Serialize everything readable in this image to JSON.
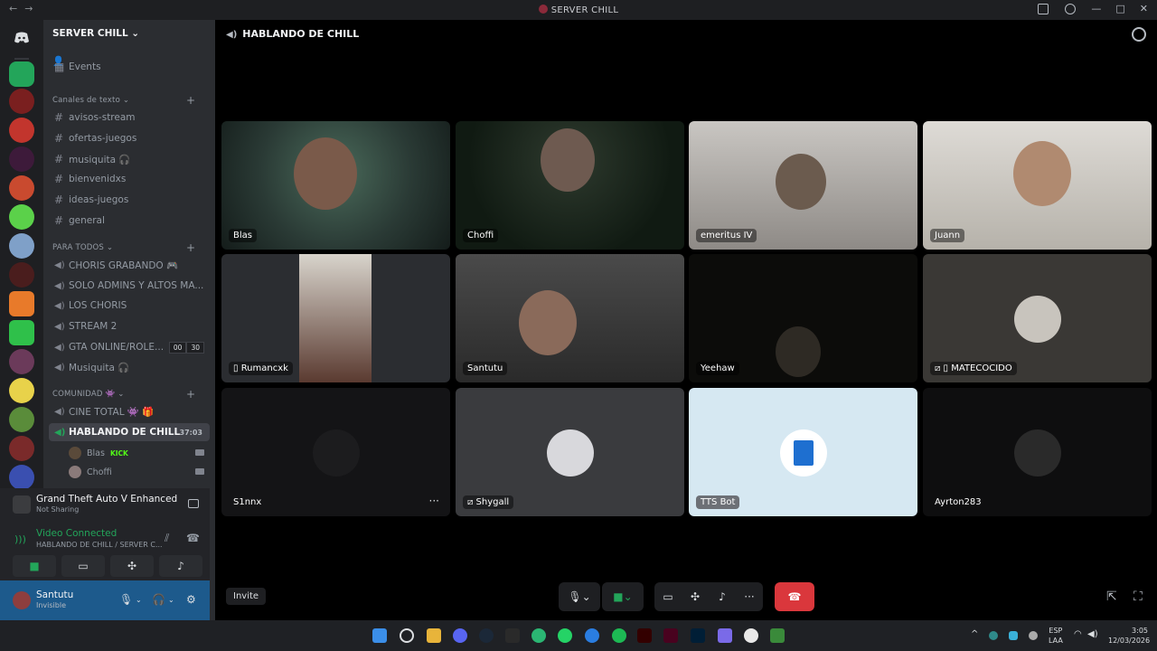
{
  "window": {
    "title": "SERVER CHILL"
  },
  "server": {
    "name": "SERVER CHILL"
  },
  "sidebar": {
    "events": "Events",
    "categories": [
      {
        "name": "Canales de texto",
        "channels": [
          "avisos-stream",
          "ofertas-juegos",
          "musiquita 🎧",
          "bienvenidxs",
          "ideas-juegos",
          "general"
        ]
      },
      {
        "name": "PARA TODOS",
        "channels": [
          "CHORIS GRABANDO 🎮",
          "SOLO ADMINS Y ALTOS MA...",
          "LOS CHORIS",
          "STREAM 2",
          "GTA ONLINE/ROLE...",
          "Musiquita 🎧"
        ]
      },
      {
        "name": "COMUNIDAD 👾",
        "channels": [
          "CINE TOTAL 👾 🎁",
          "HABLANDO DE CHILL"
        ]
      }
    ],
    "gta_counts": [
      "00",
      "30"
    ],
    "active_channel_timer": "37:03",
    "members": [
      {
        "name": "Blas",
        "tag": "KICK"
      },
      {
        "name": "Choffi",
        "tag": ""
      }
    ]
  },
  "activity": {
    "title": "Grand Theft Auto V Enhanced",
    "status": "Not Sharing"
  },
  "voice": {
    "status": "Video Connected",
    "location": "HABLANDO DE CHILL / SERVER C..."
  },
  "user": {
    "name": "Santutu",
    "status": "Invisible"
  },
  "stage": {
    "channel": "HABLANDO DE CHILL",
    "invite_label": "Invite",
    "tiles": [
      {
        "name": "Blas",
        "kind": "video"
      },
      {
        "name": "Choffi",
        "kind": "video"
      },
      {
        "name": "emeritus IV",
        "kind": "video"
      },
      {
        "name": "Juann",
        "kind": "video"
      },
      {
        "name": "Rumancxk",
        "kind": "video"
      },
      {
        "name": "Santutu",
        "kind": "video"
      },
      {
        "name": "Yeehaw",
        "kind": "video"
      },
      {
        "name": "MATECOCIDO",
        "kind": "avatar"
      },
      {
        "name": "S1nnx",
        "kind": "avatar"
      },
      {
        "name": "Shygall",
        "kind": "avatar"
      },
      {
        "name": "TTS Bot",
        "kind": "avatar"
      },
      {
        "name": "Ayrton283",
        "kind": "avatar"
      }
    ]
  },
  "taskbar": {
    "lang": "ESP",
    "layout": "LAA",
    "time": "3:05",
    "date": "12/03/2026"
  },
  "colors": {
    "green": "#23a55a",
    "hangup": "#da373c",
    "user_panel": "#1d5a8c"
  }
}
